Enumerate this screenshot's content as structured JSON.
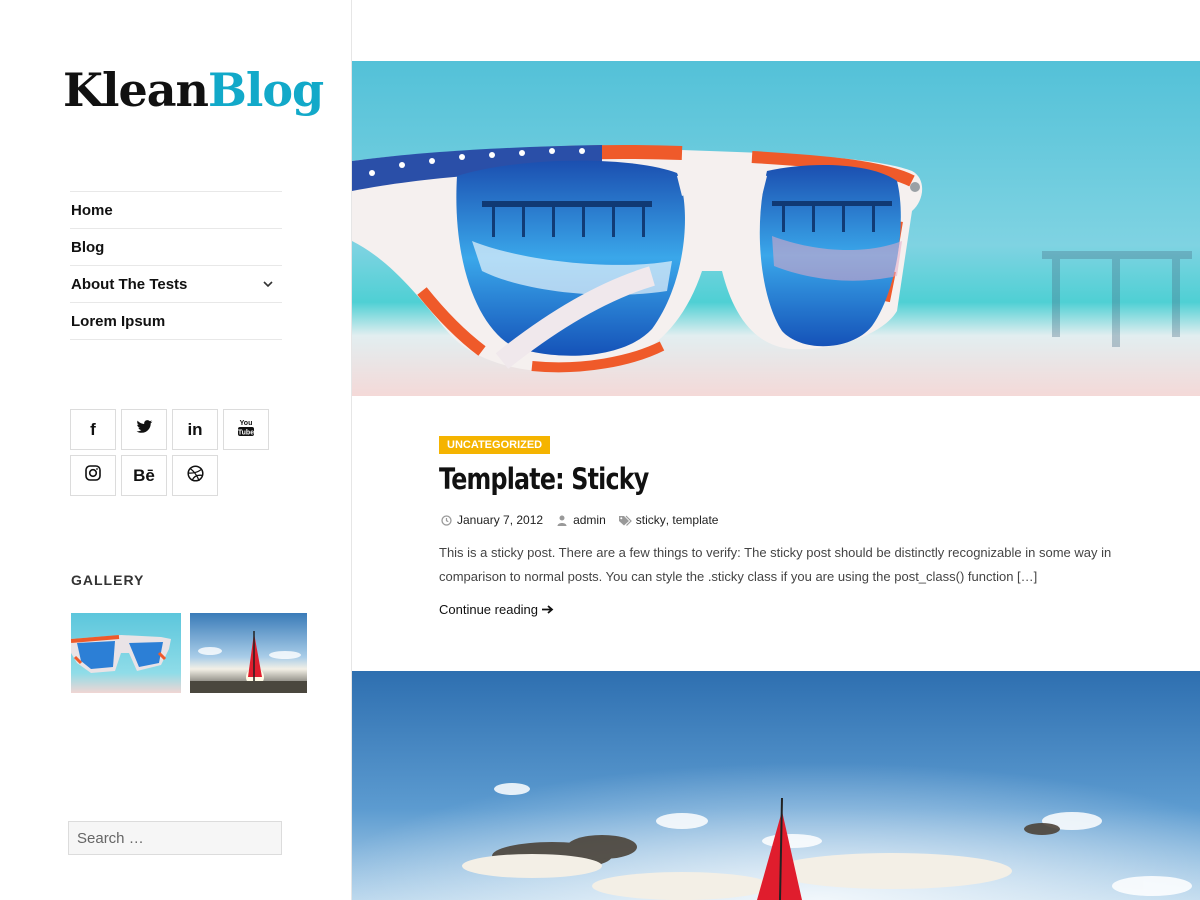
{
  "site": {
    "logo_part1": "Klean",
    "logo_part2": "Blog"
  },
  "nav": {
    "items": [
      {
        "label": "Home"
      },
      {
        "label": "Blog"
      },
      {
        "label": "About The Tests",
        "has_submenu": true
      },
      {
        "label": "Lorem Ipsum"
      }
    ]
  },
  "social": {
    "icons": [
      "facebook-icon",
      "twitter-icon",
      "linkedin-icon",
      "youtube-icon",
      "instagram-icon",
      "behance-icon",
      "dribbble-icon"
    ],
    "behance_text": "Bē",
    "linkedin_text": "in",
    "facebook_text": "f"
  },
  "gallery": {
    "title": "GALLERY"
  },
  "search": {
    "placeholder": "Search …"
  },
  "post": {
    "category": "UNCATEGORIZED",
    "title": "Template: Sticky",
    "date": "January 7, 2012",
    "author": "admin",
    "tag1": "sticky",
    "tag2": "template",
    "excerpt": "This is a sticky post. There are a few things to verify: The sticky post should be distinctly recognizable in some way in comparison to normal posts. You can style the .sticky class if you are using the post_class() function […]",
    "continue_label": "Continue reading"
  },
  "colors": {
    "accent": "#12a9c9",
    "category_bg": "#f5b400"
  }
}
